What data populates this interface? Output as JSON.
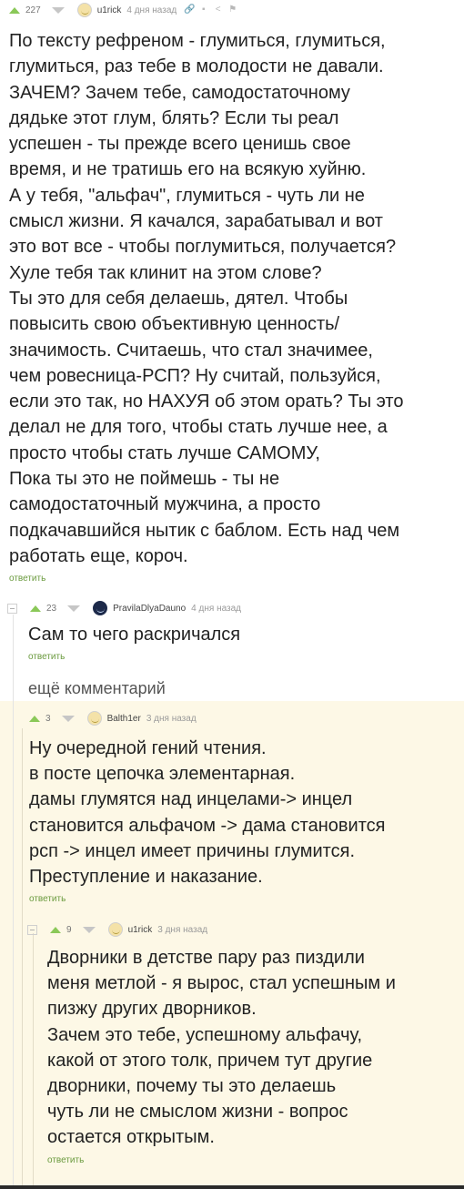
{
  "comments": [
    {
      "rating": "227",
      "author": "u1rick",
      "time": "4 дня назад",
      "text": "По тексту рефреном - глумиться, глумиться,\nглумиться, раз тебе в молодости не давали.\nЗАЧЕМ? Зачем тебе, самодостаточному\nдядьке этот глум, блять? Если ты реал\nуспешен - ты прежде всего ценишь свое\nвремя, и не тратишь его на всякую хуйню.\nА у тебя, \"альфач\", глумиться - чуть ли не\nсмысл жизни. Я качался, зарабатывал и вот\nэто вот все - чтобы поглумиться, получается?\nХуле тебя так клинит на этом слове?\nТы это для себя делаешь, дятел. Чтобы\nповысить свою объективную ценность/\nзначимость. Считаешь, что стал значимее,\nчем ровесница-РСП? Ну считай, пользуйся,\nесли это так, но НАХУЯ об этом орать? Ты это\nделал не для того, чтобы стать лучше нее, а\nпросто чтобы стать лучше САМОМУ,\nПока ты это не поймешь - ты не\nсамодостаточный мужчина, а просто\nподкачавшийся нытик с баблом. Есть над чем\nработать еще, короч.",
      "reply": "ответить"
    },
    {
      "rating": "23",
      "author": "PravilaDlyaDauno",
      "time": "4 дня назад",
      "text": "Сам то чего раскричался",
      "reply": "ответить"
    },
    {
      "rating": "3",
      "author": "Balth1er",
      "time": "3 дня назад",
      "text": "Ну очередной гений чтения.\nв посте цепочка элементарная.\nдамы глумятся над инцелами-> инцел\nстановится альфачом -> дама становится\nрсп -> инцел имеет причины глумится.\nПреступление и наказание.",
      "reply": "ответить"
    },
    {
      "rating": "9",
      "author": "u1rick",
      "time": "3 дня назад",
      "text": "Дворники в детстве пару раз пиздили\nменя метлой - я вырос, стал успешным и\nпизжу других дворников.\nЗачем это тебе, успешному альфачу,\nкакой от этого толк, причем тут другие\nдворники, почему ты это делаешь\nчуть ли не смыслом жизни - вопрос\nостается открытым.",
      "reply": "ответить"
    }
  ],
  "more_comments": "ещё комментарий",
  "colors": {
    "upvote": "#8ac858",
    "reply": "#6a9a3e",
    "highlight_bg": "#fdf8e6"
  }
}
